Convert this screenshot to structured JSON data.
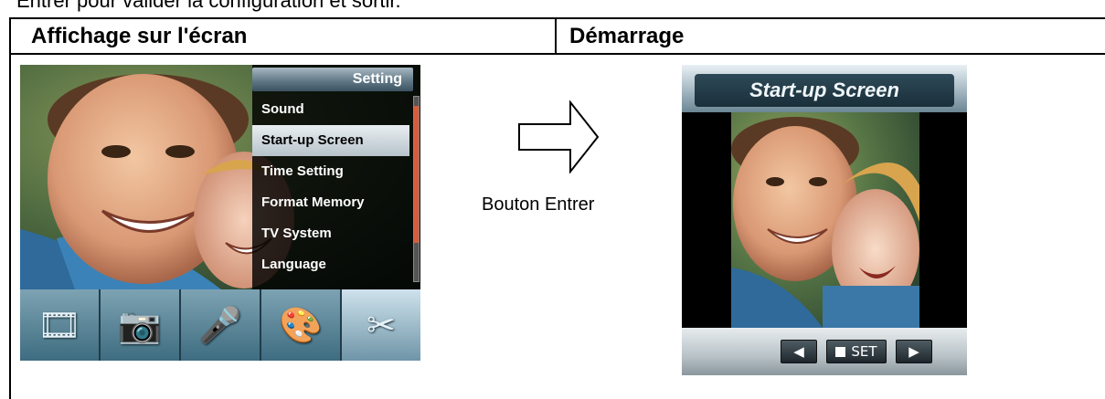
{
  "intro_text": "Entrer pour valider la configuration et sortir.",
  "table": {
    "header_left": "Affichage sur l'écran",
    "header_right": "Démarrage"
  },
  "left_screen": {
    "menu_title": "Setting",
    "menu_items": [
      "Sound",
      "Start-up Screen",
      "Time Setting",
      "Format Memory",
      "TV System",
      "Language"
    ],
    "selected_index": 1,
    "icons": [
      {
        "name": "film-reel-icon",
        "glyph": "🎞"
      },
      {
        "name": "camera-icon",
        "glyph": "📷"
      },
      {
        "name": "microphone-icon",
        "glyph": "🎤"
      },
      {
        "name": "palette-icon",
        "glyph": "🎨"
      },
      {
        "name": "tools-icon",
        "glyph": "✂"
      }
    ],
    "active_icon_index": 4
  },
  "arrow_caption": "Bouton Entrer",
  "right_screen": {
    "title": "Start-up Screen",
    "nav_left_icon": "left-arrow-icon",
    "nav_set_label": "SET",
    "nav_right_icon": "right-arrow-icon"
  },
  "colors": {
    "selection_bg": "#d6dde2",
    "scroll_thumb": "#d85b3a",
    "icon_bar": "#4f7e92"
  }
}
